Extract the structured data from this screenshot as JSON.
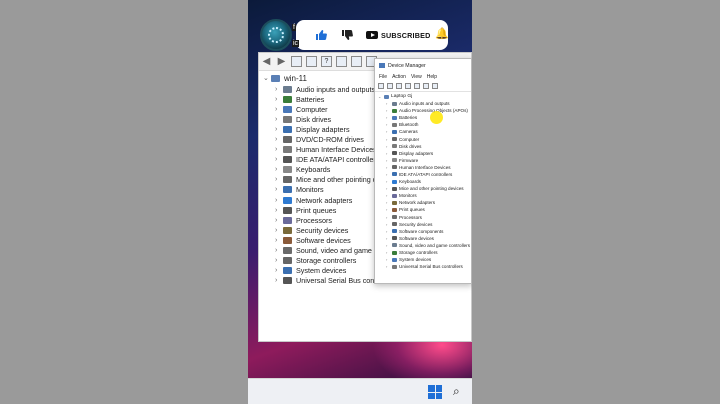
{
  "overlay": {
    "channel_initial": "f",
    "channel_initial2": "ic",
    "subscribe_label": "SUBSCRIBED",
    "bell_icon": "bell-icon"
  },
  "back_window": {
    "root": "win-11",
    "items": [
      "Audio inputs and outputs",
      "Batteries",
      "Computer",
      "Disk drives",
      "Display adapters",
      "DVD/CD-ROM drives",
      "Human Interface Devices",
      "IDE ATA/ATAPI controllers",
      "Keyboards",
      "Mice and other pointing dev",
      "Monitors",
      "Network adapters",
      "Print queues",
      "Processors",
      "Security devices",
      "Software devices",
      "Sound, video and game cont",
      "Storage controllers",
      "System devices",
      "Universal Serial Bus control"
    ]
  },
  "front_window": {
    "title": "Device Manager",
    "menu": [
      "File",
      "Action",
      "View",
      "Help"
    ],
    "root": "Laptop Gj",
    "items": [
      "Audio inputs and outputs",
      "Audio Processing Objects (APOs)",
      "Batteries",
      "Bluetooth",
      "Cameras",
      "Computer",
      "Disk drives",
      "Display adapters",
      "Firmware",
      "Human Interface Devices",
      "IDE ATA/ATAPI controllers",
      "Keyboards",
      "Mice and other pointing devices",
      "Monitors",
      "Network adapters",
      "Print queues",
      "Processors",
      "Security devices",
      "Software components",
      "Software devices",
      "Sound, video and game controllers",
      "Storage controllers",
      "System devices",
      "Universal Serial Bus controllers"
    ]
  },
  "colors": {
    "accent": "#1f6fd6",
    "cursor_highlight": "#ffe600"
  }
}
